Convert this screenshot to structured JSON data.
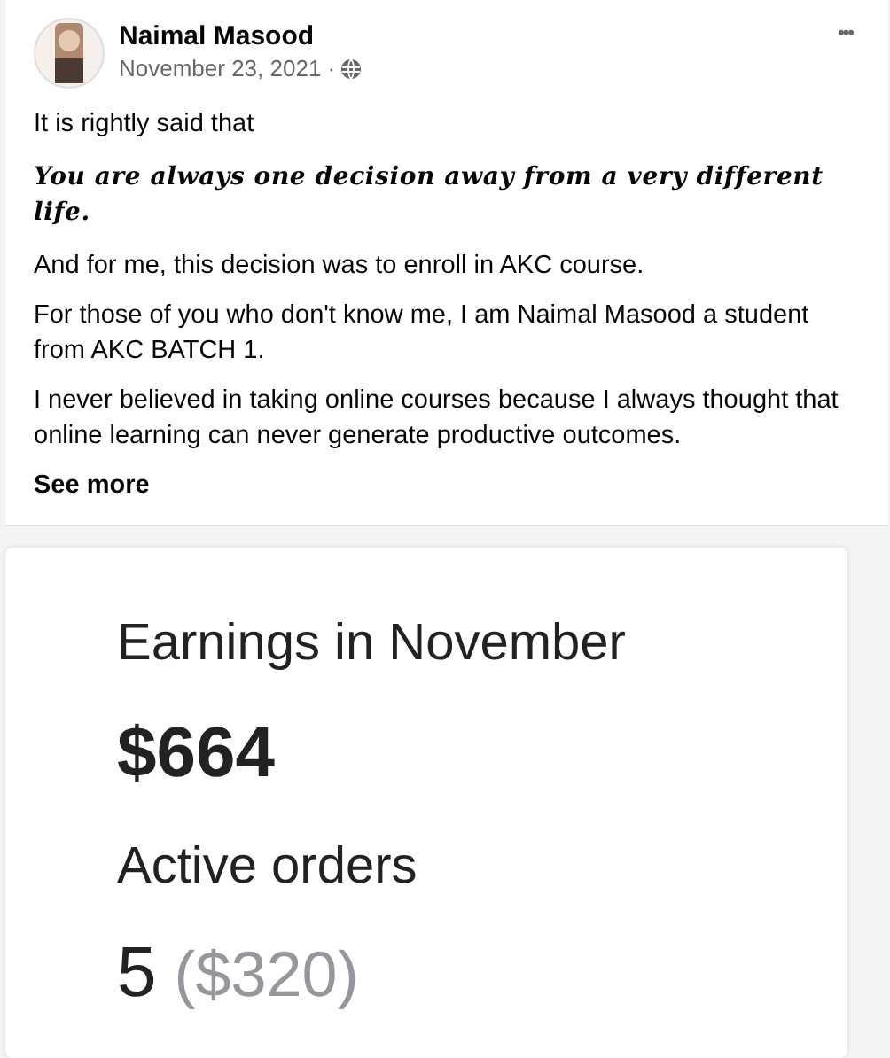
{
  "post": {
    "author": "Naimal Masood",
    "date": "November 23, 2021 ·",
    "more_menu": "•••",
    "paragraphs": [
      {
        "kind": "plain",
        "text": "It is rightly said that"
      },
      {
        "kind": "quote",
        "text": "You are always one decision away from a very different life."
      },
      {
        "kind": "plain",
        "text": "And for me, this decision was to enroll in AKC course."
      },
      {
        "kind": "plain",
        "text": "For those of you who don't know me, I am Naimal Masood a student from AKC BATCH 1."
      },
      {
        "kind": "plain",
        "text": "I never believed in taking online courses because I always thought that online learning can never generate productive outcomes."
      }
    ],
    "see_more": "See more"
  },
  "screenshot": {
    "earnings_label": "Earnings in November",
    "earnings_value": "$664",
    "orders_label": "Active orders",
    "orders_count": "5",
    "orders_value": "($320)"
  }
}
